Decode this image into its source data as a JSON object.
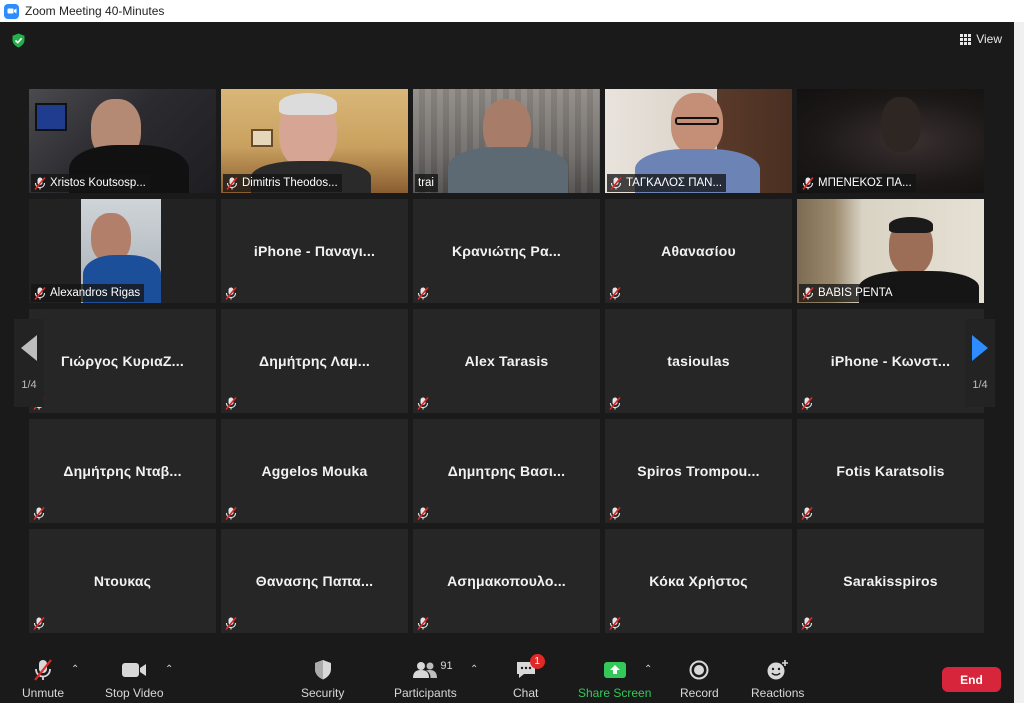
{
  "window": {
    "title": "Zoom Meeting 40-Minutes"
  },
  "top": {
    "view_label": "View"
  },
  "tiles": [
    {
      "name": "Xristos Koutsosp...",
      "video": true
    },
    {
      "name": "Dimitris Theodos...",
      "video": true
    },
    {
      "name": "trai",
      "video": true,
      "active": true
    },
    {
      "name": "ΤΑΓΚΑΛΟΣ ΠΑΝ...",
      "video": true
    },
    {
      "name": "ΜΠΕΝΕΚΟΣ ΠΑ...",
      "video": true
    },
    {
      "name": "Alexandros Rigas",
      "video": true
    },
    {
      "name": "iPhone - Παναγι...",
      "video": false
    },
    {
      "name": "Κρανιώτης Ρα...",
      "video": false
    },
    {
      "name": "Αθανασίου",
      "video": false
    },
    {
      "name": "BABIS PENTA",
      "video": true
    },
    {
      "name": "Γιώργος ΚυριαΖ...",
      "video": false
    },
    {
      "name": "Δημήτρης Λαμ...",
      "video": false
    },
    {
      "name": "Alex Tarasis",
      "video": false
    },
    {
      "name": "tasioulas",
      "video": false
    },
    {
      "name": "iPhone - Κωνστ...",
      "video": false
    },
    {
      "name": "Δημήτρης Νταβ...",
      "video": false
    },
    {
      "name": "Aggelos Mouka",
      "video": false
    },
    {
      "name": "Δημητρης Βασι...",
      "video": false
    },
    {
      "name": "Spiros Trompou...",
      "video": false
    },
    {
      "name": "Fotis Karatsolis",
      "video": false
    },
    {
      "name": "Ντουκας",
      "video": false
    },
    {
      "name": "Θανασης Παπα...",
      "video": false
    },
    {
      "name": "Ασημακοπουλο...",
      "video": false
    },
    {
      "name": "Κόκα Χρήστος",
      "video": false
    },
    {
      "name": "Sarakisspiros",
      "video": false
    }
  ],
  "pager": {
    "left": "1/4",
    "right": "1/4"
  },
  "toolbar": {
    "unmute": "Unmute",
    "stop_video": "Stop Video",
    "security": "Security",
    "participants": "Participants",
    "participants_count": "91",
    "chat": "Chat",
    "chat_badge": "1",
    "share_screen": "Share Screen",
    "record": "Record",
    "reactions": "Reactions",
    "end": "End"
  },
  "colors": {
    "accent_blue": "#2d8cff",
    "share_green": "#34c759",
    "end_red": "#d7263b",
    "active_speaker": "#c8d66a",
    "mute_red": "#e02828"
  }
}
